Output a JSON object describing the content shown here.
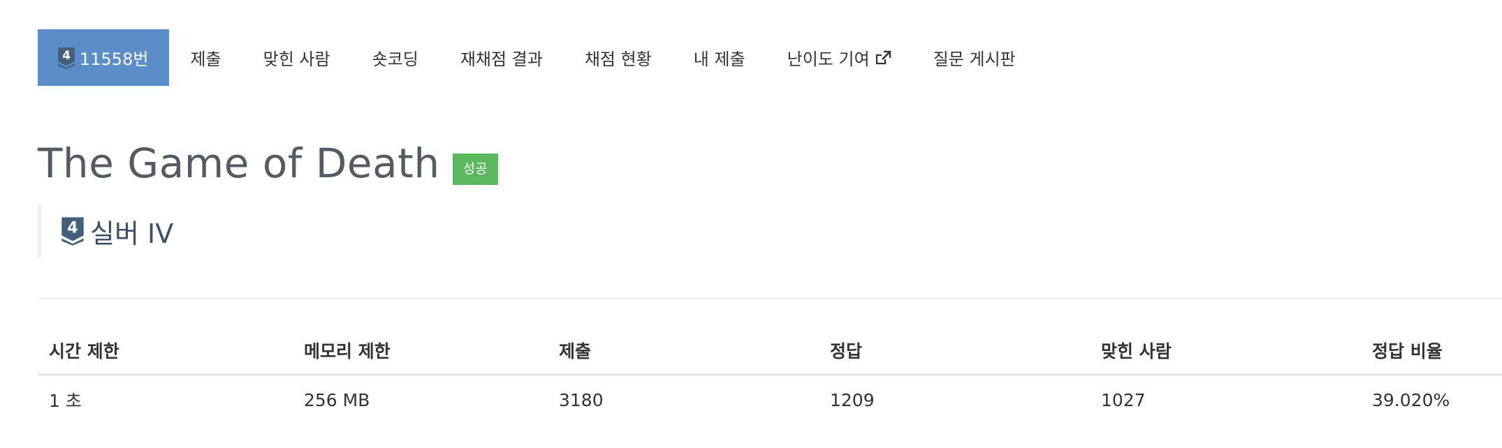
{
  "tabs": [
    {
      "label": "11558번",
      "active": true,
      "tier_number": "4"
    },
    {
      "label": "제출"
    },
    {
      "label": "맞힌 사람"
    },
    {
      "label": "숏코딩"
    },
    {
      "label": "재채점 결과"
    },
    {
      "label": "채점 현황"
    },
    {
      "label": "내 제출"
    },
    {
      "label": "난이도 기여",
      "icon": "external-link-icon"
    },
    {
      "label": "질문 게시판"
    }
  ],
  "problem": {
    "title": "The Game of Death",
    "status_badge": "성공",
    "tier_number": "4",
    "tier_label": "실버 IV"
  },
  "stats": {
    "headers": [
      "시간 제한",
      "메모리 제한",
      "제출",
      "정답",
      "맞힌 사람",
      "정답 비율"
    ],
    "values": [
      "1 초",
      "256 MB",
      "3180",
      "1209",
      "1027",
      "39.020%"
    ]
  },
  "colors": {
    "active_tab_bg": "#5b8ec9",
    "success_badge_bg": "#5cb85c",
    "tier_silver": "#435f7a",
    "title_text": "#555a63"
  }
}
